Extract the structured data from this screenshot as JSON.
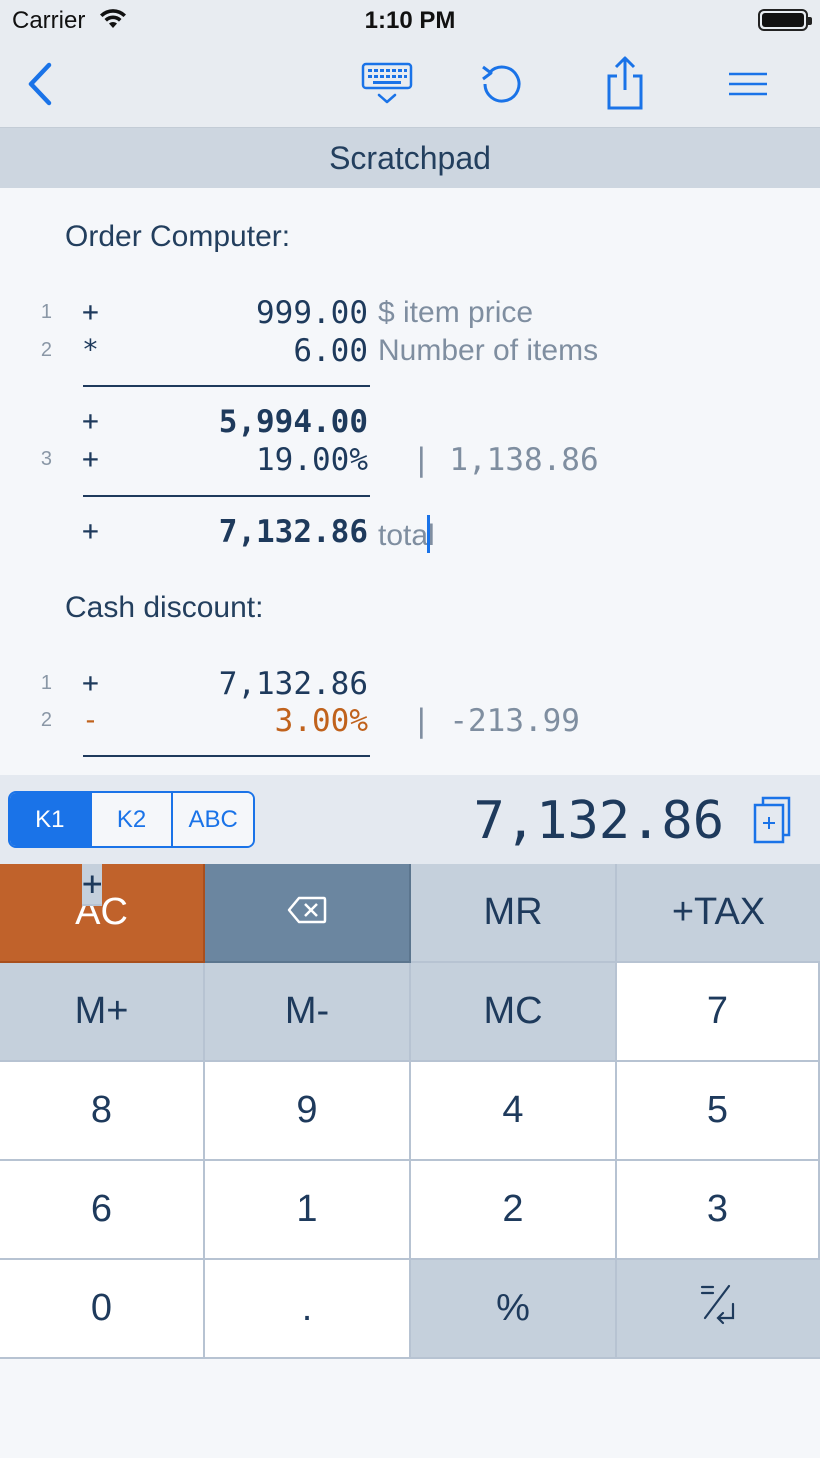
{
  "status_bar": {
    "carrier": "Carrier",
    "time": "1:10 PM"
  },
  "nav": {
    "back_icon": "chevron-left-icon",
    "keyboard_icon": "keyboard-hide-icon",
    "undo_icon": "undo-icon",
    "share_icon": "share-icon",
    "menu_icon": "hamburger-menu-icon",
    "accent_color": "#1a73e8"
  },
  "title": "Scratchpad",
  "scratchpad": {
    "sections": [
      {
        "heading": "Order Computer:",
        "lines": [
          {
            "line": "1",
            "op": "+",
            "value": "999.00",
            "comment": "$ item price"
          },
          {
            "line": "2",
            "op": "*",
            "value": "6.00",
            "comment": "Number of items"
          },
          {
            "line": "",
            "op": "+",
            "value": "5,994.00",
            "comment": ""
          },
          {
            "line": "3",
            "op": "+",
            "value": "19.00%",
            "extra": "| 1,138.86"
          },
          {
            "line": "",
            "op": "+",
            "value": "7,132.86",
            "comment": "total"
          }
        ]
      },
      {
        "heading": "Cash discount:",
        "lines": [
          {
            "line": "1",
            "op": "+",
            "value": "7,132.86"
          },
          {
            "line": "2",
            "op": "-",
            "value": "3.00%",
            "extra": "| -213.99"
          }
        ]
      }
    ]
  },
  "memory_tabs": {
    "items": [
      "K1",
      "K2",
      "ABC"
    ],
    "selected": "K1"
  },
  "display": {
    "value": "7,132.86",
    "copy_icon": "copy-plus-icon"
  },
  "keypad": {
    "row1": [
      "AC",
      "",
      "MR",
      "+TAX"
    ],
    "row2": [
      "M+",
      "M-",
      "MC",
      "÷"
    ],
    "row3": [
      "7",
      "8",
      "9",
      "×"
    ],
    "row4": [
      "4",
      "5",
      "6",
      "-"
    ],
    "row5": [
      "1",
      "2",
      "3",
      "+"
    ],
    "row6": [
      "0",
      ".",
      "%",
      ""
    ],
    "backspace_icon": "backspace-icon",
    "enter_icon": "equals-enter-icon",
    "ac_color": "#c0622b",
    "backspace_color": "#6b86a0"
  }
}
